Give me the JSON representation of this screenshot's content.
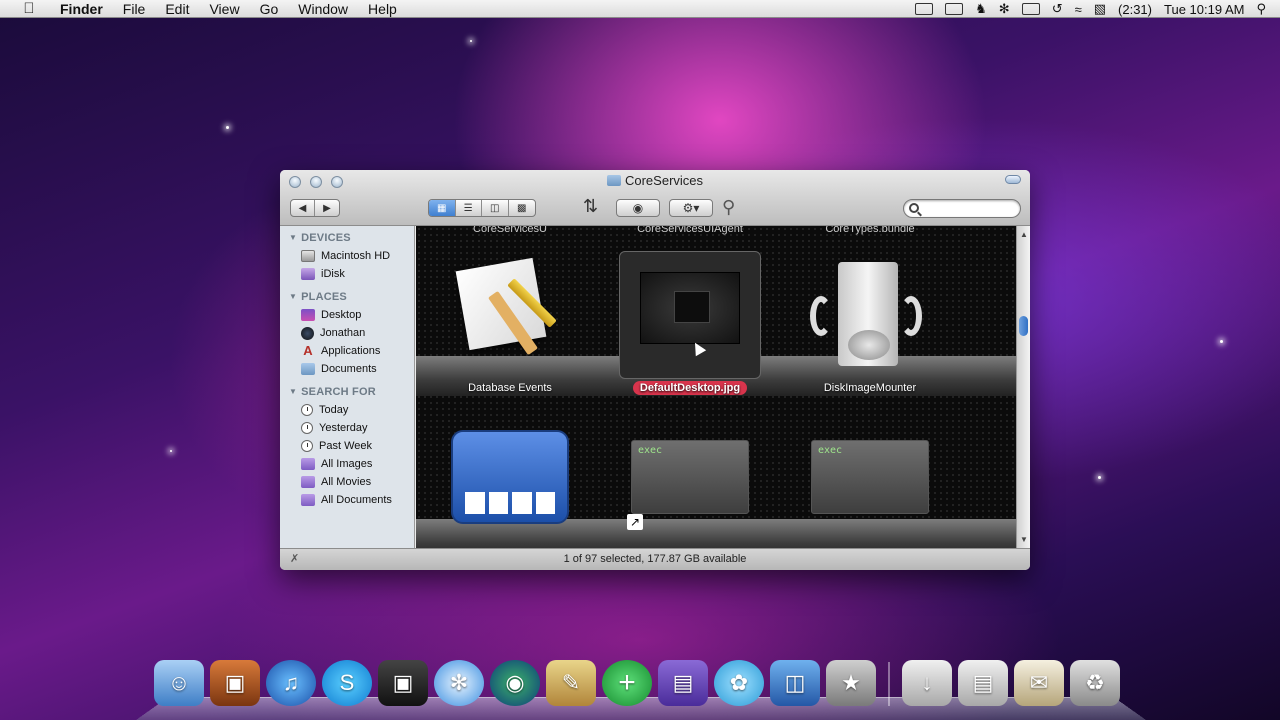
{
  "menubar": {
    "app_name": "Finder",
    "items": [
      "File",
      "Edit",
      "View",
      "Go",
      "Window",
      "Help"
    ],
    "battery": "(2:31)",
    "clock": "Tue 10:19 AM"
  },
  "window": {
    "title": "CoreServices",
    "status": "1 of 97 selected, 177.87 GB available"
  },
  "sidebar": {
    "devices_header": "DEVICES",
    "devices": [
      "Macintosh HD",
      "iDisk"
    ],
    "places_header": "PLACES",
    "places": [
      "Desktop",
      "Jonathan",
      "Applications",
      "Documents"
    ],
    "search_header": "SEARCH FOR",
    "search": [
      "Today",
      "Yesterday",
      "Past Week",
      "All Images",
      "All Movies",
      "All Documents"
    ]
  },
  "content": {
    "top_cut": [
      "CoreServicesU",
      "CoreServicesUIAgent",
      "CoreTypes.bundle"
    ],
    "row1": [
      "Database Events",
      "DefaultDesktop.jpg",
      "DiskImageMounter"
    ],
    "exec_badge": "exec"
  },
  "icons": {
    "search": "magnifier-icon"
  }
}
